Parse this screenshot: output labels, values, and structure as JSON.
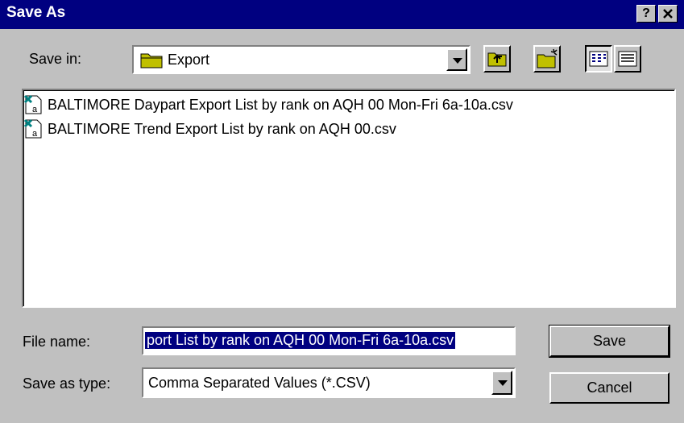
{
  "window": {
    "title": "Save As",
    "help_label": "?",
    "close_label": "✕"
  },
  "toolbar": {
    "save_in_label": "Save in:",
    "save_in_value": "Export",
    "up_folder_icon": "up-folder-icon",
    "new_folder_icon": "new-folder-icon",
    "list_view_icon": "list-view-icon",
    "details_view_icon": "details-view-icon"
  },
  "files": [
    {
      "name": "BALTIMORE Daypart Export List by rank on AQH 00 Mon-Fri 6a-10a.csv",
      "icon": "csv-file-icon"
    },
    {
      "name": "BALTIMORE Trend Export List by rank on AQH 00.csv",
      "icon": "csv-file-icon"
    }
  ],
  "form": {
    "file_name_label": "File name:",
    "file_name_value": "port List by rank on AQH 00 Mon-Fri 6a-10a.csv",
    "save_type_label": "Save as type:",
    "save_type_value": "Comma Separated Values (*.CSV)"
  },
  "buttons": {
    "save": "Save",
    "cancel": "Cancel"
  },
  "colors": {
    "titlebar": "#000080",
    "face": "#c0c0c0",
    "selection": "#000080"
  }
}
